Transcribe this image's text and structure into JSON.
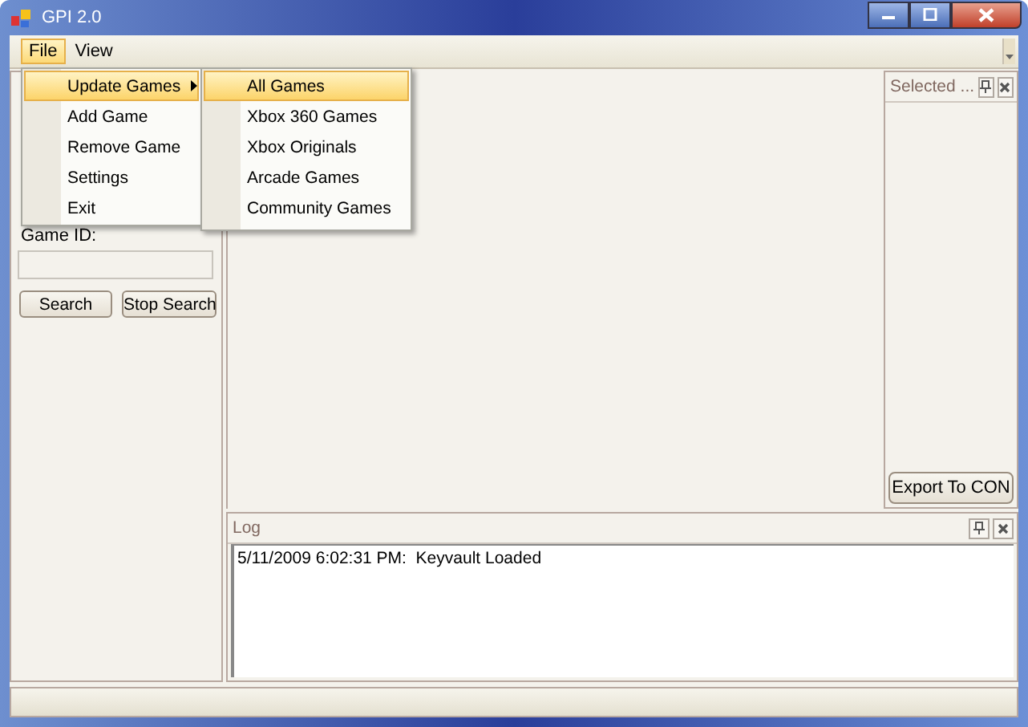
{
  "window": {
    "title": "GPI 2.0"
  },
  "menu_bar": [
    {
      "label": "File",
      "selected": true
    },
    {
      "label": "View",
      "selected": false
    }
  ],
  "file_menu": [
    {
      "label": "Update Games",
      "selected": true,
      "has_submenu": true
    },
    {
      "label": "Add Game",
      "selected": false,
      "has_submenu": false
    },
    {
      "label": "Remove Game",
      "selected": false,
      "has_submenu": false
    },
    {
      "label": "Settings",
      "selected": false,
      "has_submenu": false
    },
    {
      "label": "Exit",
      "selected": false,
      "has_submenu": false
    }
  ],
  "submenu": [
    {
      "label": "All Games",
      "selected": true
    },
    {
      "label": "Xbox 360 Games",
      "selected": false
    },
    {
      "label": "Xbox Originals",
      "selected": false
    },
    {
      "label": "Arcade Games",
      "selected": false
    },
    {
      "label": "Community Games",
      "selected": false
    }
  ],
  "search_panel": {
    "game_id_label": "Game ID:",
    "buttons": [
      "Search",
      "Stop Search"
    ]
  },
  "selected_panel": {
    "title": "Selected ...",
    "button": "Export To CON"
  },
  "log_panel": {
    "title": "Log",
    "lines": [
      "5/11/2009 6:02:31 PM:  Keyvault Loaded"
    ]
  }
}
